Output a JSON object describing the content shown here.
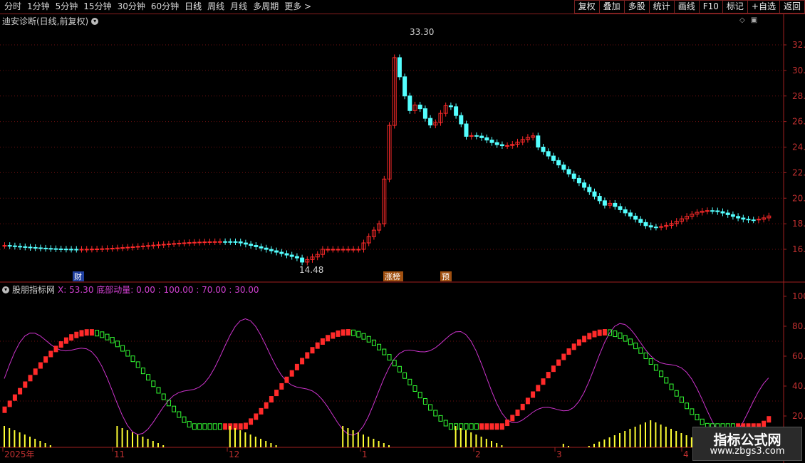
{
  "toolbar": {
    "periods": [
      "分时",
      "1分钟",
      "5分钟",
      "15分钟",
      "30分钟",
      "60分钟",
      "日线",
      "周线",
      "月线",
      "多周期",
      "更多 >"
    ],
    "active_period": "日线",
    "buttons": [
      "复权",
      "叠加",
      "多股",
      "统计",
      "画线",
      "F10",
      "标记",
      "+自选",
      "返回"
    ]
  },
  "main_chart": {
    "title": "迪安诊断(日线,前复权)",
    "price_axis": [
      "32.00",
      "30.00",
      "28.00",
      "26.00",
      "24.00",
      "22.00",
      "20.00",
      "18.00",
      "16.00"
    ],
    "high_label": "33.30",
    "low_label": "14.48",
    "event_tags": [
      "财",
      "涨榜",
      "预"
    ]
  },
  "indicator": {
    "name": "股朋指标网",
    "values_text": "X: 53.30  底部动量: 0.00 : 100.00 : 70.00 : 30.00",
    "axis": [
      "100.0",
      "80.00",
      "60.00",
      "40.00",
      "20.00"
    ]
  },
  "date_axis": [
    "2025年",
    "11",
    "12",
    "1",
    "2",
    "3",
    "4"
  ],
  "watermark": {
    "title": "指标公式网",
    "url": "www.zbgs3.com"
  },
  "colors": {
    "up": "#ff2a2a",
    "down": "#54ffff",
    "grid": "#6e1010",
    "line": "#cc33cc",
    "yellow": "#ffff33",
    "green": "#33ff33"
  }
}
